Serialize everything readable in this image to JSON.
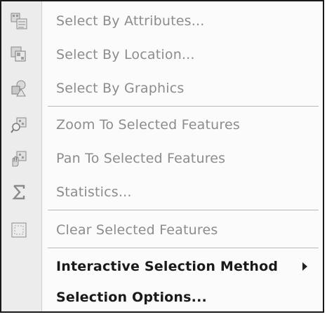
{
  "menu": {
    "items": [
      {
        "label": "Select By Attributes...",
        "icon": "select-by-attributes-icon",
        "enabled": false
      },
      {
        "label": "Select By Location...",
        "icon": "select-by-location-icon",
        "enabled": false
      },
      {
        "label": "Select By Graphics",
        "icon": "select-by-graphics-icon",
        "enabled": false
      },
      {
        "label": "Zoom To Selected Features",
        "icon": "zoom-to-selected-icon",
        "enabled": false
      },
      {
        "label": "Pan To Selected Features",
        "icon": "pan-to-selected-icon",
        "enabled": false
      },
      {
        "label": "Statistics...",
        "icon": "statistics-sigma-icon",
        "enabled": false
      },
      {
        "label": "Clear Selected Features",
        "icon": "clear-selection-icon",
        "enabled": false
      },
      {
        "label": "Interactive Selection Method",
        "enabled": true,
        "has_submenu": true
      },
      {
        "label": "Selection Options...",
        "enabled": true
      }
    ],
    "colors": {
      "disabled_text": "#8c8c8c",
      "enabled_text": "#1a1a1a",
      "gutter": "#ececec",
      "border": "#1a1a1a"
    }
  }
}
